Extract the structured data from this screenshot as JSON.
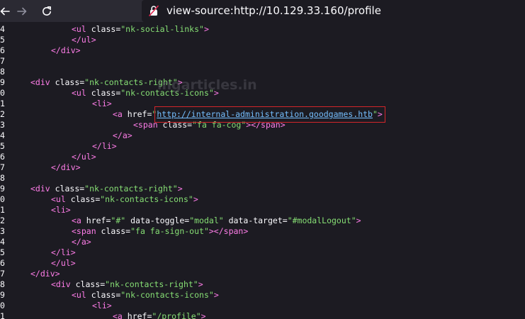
{
  "browser": {
    "url": "view-source:http://10.129.33.160/profile",
    "icons": [
      "back-arrow-icon",
      "forward-arrow-icon",
      "reload-icon",
      "lock-icon"
    ]
  },
  "watermark": "ingarticles.in",
  "colors": {
    "tag": "#ff7de9",
    "attribute": "#fbfbfe",
    "value": "#86de74",
    "link": "#75bfff",
    "highlight": "#d4262a"
  },
  "source": {
    "lines": [
      {
        "num": "4",
        "indent": 8,
        "parts": [
          [
            "t",
            "<ul "
          ],
          [
            "a",
            "class="
          ],
          [
            "q",
            "\"nk-social-links\""
          ],
          [
            "t",
            ">"
          ]
        ]
      },
      {
        "num": "5",
        "indent": 8,
        "parts": [
          [
            "t",
            "</ul>"
          ]
        ]
      },
      {
        "num": "6",
        "indent": 4,
        "parts": [
          [
            "t",
            "</div>"
          ]
        ]
      },
      {
        "num": "7",
        "indent": 0,
        "parts": []
      },
      {
        "num": "8",
        "indent": 0,
        "parts": []
      },
      {
        "num": "9",
        "indent": 0,
        "parts": [
          [
            "t",
            "<div "
          ],
          [
            "a",
            "class="
          ],
          [
            "q",
            "\"nk-contacts-right\""
          ],
          [
            "t",
            ">"
          ]
        ]
      },
      {
        "num": "0",
        "indent": 8,
        "parts": [
          [
            "t",
            "<ul "
          ],
          [
            "a",
            "class="
          ],
          [
            "q",
            "\"nk-contacts-icons\""
          ],
          [
            "t",
            ">"
          ]
        ]
      },
      {
        "num": "1",
        "indent": 12,
        "parts": [
          [
            "t",
            "<li>"
          ]
        ]
      },
      {
        "num": "2",
        "indent": 16,
        "parts": [
          [
            "t",
            "<a "
          ],
          [
            "a",
            "href="
          ],
          [
            "q",
            "\""
          ],
          [
            "l",
            "http://internal-administration.goodgames.htb"
          ],
          [
            "q",
            "\""
          ],
          [
            "t",
            ">"
          ]
        ]
      },
      {
        "num": "3",
        "indent": 20,
        "parts": [
          [
            "t",
            "<span "
          ],
          [
            "a",
            "class="
          ],
          [
            "q",
            "\"fa fa-cog\""
          ],
          [
            "t",
            "></span>"
          ]
        ]
      },
      {
        "num": "4",
        "indent": 16,
        "parts": [
          [
            "t",
            "</a>"
          ]
        ]
      },
      {
        "num": "5",
        "indent": 12,
        "parts": [
          [
            "t",
            "</li>"
          ]
        ]
      },
      {
        "num": "6",
        "indent": 8,
        "parts": [
          [
            "t",
            "</ul>"
          ]
        ]
      },
      {
        "num": "7",
        "indent": 4,
        "parts": [
          [
            "t",
            "</div>"
          ]
        ]
      },
      {
        "num": "8",
        "indent": 0,
        "parts": []
      },
      {
        "num": "9",
        "indent": 0,
        "parts": [
          [
            "t",
            "<div "
          ],
          [
            "a",
            "class="
          ],
          [
            "q",
            "\"nk-contacts-right\""
          ],
          [
            "t",
            ">"
          ]
        ]
      },
      {
        "num": "0",
        "indent": 4,
        "parts": [
          [
            "t",
            "<ul "
          ],
          [
            "a",
            "class="
          ],
          [
            "q",
            "\"nk-contacts-icons\""
          ],
          [
            "t",
            ">"
          ]
        ]
      },
      {
        "num": "1",
        "indent": 4,
        "parts": [
          [
            "t",
            "<li>"
          ]
        ]
      },
      {
        "num": "2",
        "indent": 8,
        "parts": [
          [
            "t",
            "<a "
          ],
          [
            "a",
            "href="
          ],
          [
            "q",
            "\"#\""
          ],
          [
            "a",
            " data-toggle="
          ],
          [
            "q",
            "\"modal\""
          ],
          [
            "a",
            " data-target="
          ],
          [
            "q",
            "\"#modalLogout\""
          ],
          [
            "t",
            ">"
          ]
        ]
      },
      {
        "num": "3",
        "indent": 8,
        "parts": [
          [
            "t",
            "<span "
          ],
          [
            "a",
            "class="
          ],
          [
            "q",
            "\"fa fa-sign-out\""
          ],
          [
            "t",
            "></span>"
          ]
        ]
      },
      {
        "num": "4",
        "indent": 8,
        "parts": [
          [
            "t",
            "</a>"
          ]
        ]
      },
      {
        "num": "5",
        "indent": 4,
        "parts": [
          [
            "t",
            "</li>"
          ]
        ]
      },
      {
        "num": "6",
        "indent": 4,
        "parts": [
          [
            "t",
            "</ul>"
          ]
        ]
      },
      {
        "num": "7",
        "indent": 0,
        "parts": [
          [
            "t",
            "</div>"
          ]
        ]
      },
      {
        "num": "8",
        "indent": 4,
        "parts": [
          [
            "t",
            "<div "
          ],
          [
            "a",
            "class="
          ],
          [
            "q",
            "\"nk-contacts-right\""
          ],
          [
            "t",
            ">"
          ]
        ]
      },
      {
        "num": "9",
        "indent": 8,
        "parts": [
          [
            "t",
            "<ul "
          ],
          [
            "a",
            "class="
          ],
          [
            "q",
            "\"nk-contacts-icons\""
          ],
          [
            "t",
            ">"
          ]
        ]
      },
      {
        "num": "0",
        "indent": 12,
        "parts": [
          [
            "t",
            "<li>"
          ]
        ]
      },
      {
        "num": "1",
        "indent": 16,
        "parts": [
          [
            "t",
            "<a "
          ],
          [
            "a",
            "href="
          ],
          [
            "q",
            "\"/profile\""
          ],
          [
            "t",
            ">"
          ]
        ]
      }
    ]
  }
}
